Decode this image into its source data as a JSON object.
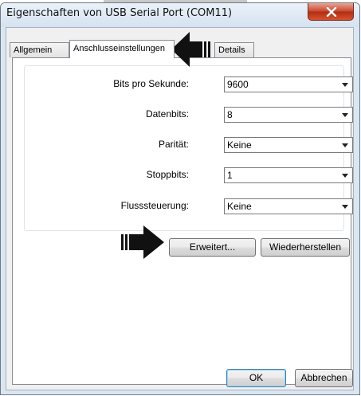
{
  "window": {
    "title": "Eigenschaften von USB Serial Port (COM11)",
    "close_icon": "close-x-icon"
  },
  "tabs": [
    {
      "label": "Allgemein"
    },
    {
      "label": "Anschlusseinstellungen"
    },
    {
      "label": "Details"
    }
  ],
  "settings": {
    "bits_label": "Bits pro Sekunde:",
    "bits_value": "9600",
    "databits_label": "Datenbits:",
    "databits_value": "8",
    "parity_label": "Parität:",
    "parity_value": "Keine",
    "stopbits_label": "Stoppbits:",
    "stopbits_value": "1",
    "flow_label": "Flusssteuerung:",
    "flow_value": "Keine"
  },
  "buttons": {
    "advanced": "Erweitert...",
    "restore": "Wiederherstellen",
    "ok": "OK",
    "cancel": "Abbrechen"
  },
  "annotations": {
    "arrow_icon_color": "#111111"
  }
}
